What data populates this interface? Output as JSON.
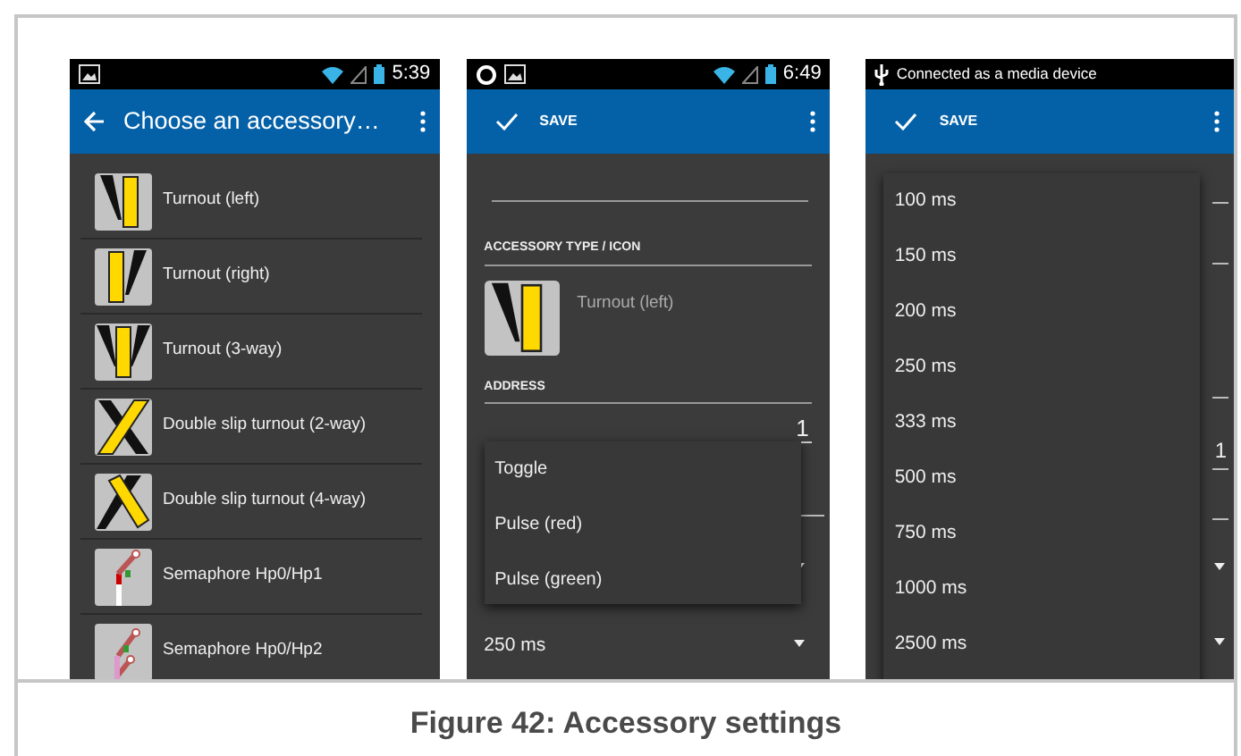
{
  "screens": [
    {
      "kind": "list",
      "status_bar": {
        "kind": "clock",
        "time": "5:39"
      },
      "app_bar": {
        "kind": "back",
        "title": "Choose an accessory…"
      },
      "items": [
        {
          "label": "Turnout (left)",
          "kind": "turnout-left"
        },
        {
          "label": "Turnout (right)",
          "kind": "turnout-right"
        },
        {
          "label": "Turnout (3-way)",
          "kind": "turnout-3way"
        },
        {
          "label": "Double slip turnout (2-way)",
          "kind": "slip-2way"
        },
        {
          "label": "Double slip turnout (4-way)",
          "kind": "slip-4way"
        },
        {
          "label": "Semaphore Hp0/Hp1",
          "kind": "semaphore-1"
        },
        {
          "label": "Semaphore Hp0/Hp2",
          "kind": "semaphore-2"
        }
      ]
    },
    {
      "kind": "form",
      "status_bar": {
        "kind": "clock",
        "time": "6:49"
      },
      "app_bar": {
        "kind": "save",
        "action": "SAVE"
      },
      "type_heading": "ACCESSORY TYPE / ICON",
      "type": {
        "label": "Turnout (left)",
        "kind": "turnout-left"
      },
      "address_heading": "ADDRESS",
      "address_value": "1",
      "pulse_length": "250 ms",
      "popup": {
        "items": [
          "Toggle",
          "Pulse (red)",
          "Pulse (green)"
        ]
      }
    },
    {
      "kind": "timing",
      "status_bar": {
        "kind": "notice",
        "text": "Connected as a media device"
      },
      "app_bar": {
        "kind": "save",
        "action": "SAVE"
      },
      "address_value": "1",
      "popup": {
        "items": [
          "100 ms",
          "150 ms",
          "200 ms",
          "250 ms",
          "333 ms",
          "500 ms",
          "750 ms",
          "1000 ms",
          "2500 ms"
        ]
      }
    }
  ],
  "figure": {
    "caption": "Figure 42: Accessory settings"
  }
}
